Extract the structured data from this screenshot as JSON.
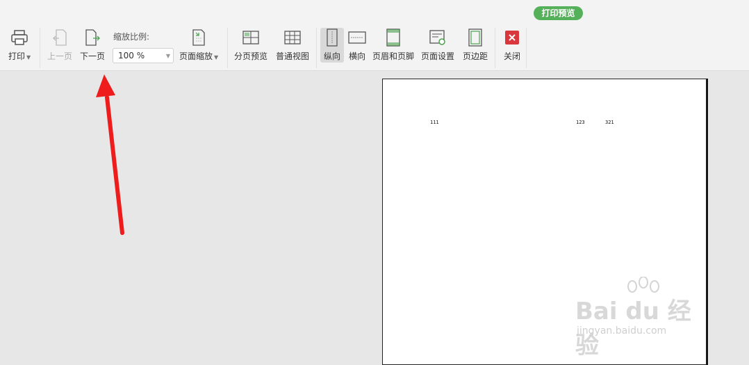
{
  "tab": {
    "label": "打印预览"
  },
  "toolbar": {
    "print": "打印",
    "prev_page": "上一页",
    "next_page": "下一页",
    "zoom_label": "缩放比例:",
    "zoom_value": "100 %",
    "page_zoom": "页面缩放",
    "page_break_preview": "分页预览",
    "normal_view": "普通视图",
    "portrait": "纵向",
    "landscape": "横向",
    "header_footer": "页眉和页脚",
    "page_setup": "页面设置",
    "margins": "页边距",
    "close": "关闭"
  },
  "page": {
    "cells": [
      "111",
      "123",
      "321"
    ]
  },
  "watermark": {
    "main": "Bai du 经验",
    "sub": "jingyan.baidu.com"
  },
  "colors": {
    "accent_green": "#55b05a",
    "arrow_red": "#ee1c1c",
    "close_red": "#d9363e"
  }
}
